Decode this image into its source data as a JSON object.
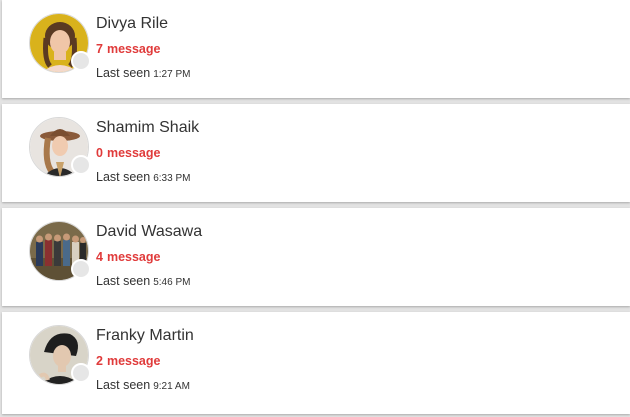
{
  "contacts": [
    {
      "name": "Divya Rile",
      "message_count": "7",
      "message_label": "message",
      "last_seen_label": "Last seen",
      "last_seen_time": "1:27 PM"
    },
    {
      "name": "Shamim Shaik",
      "message_count": "0",
      "message_label": "message",
      "last_seen_label": "Last seen",
      "last_seen_time": "6:33 PM"
    },
    {
      "name": "David Wasawa",
      "message_count": "4",
      "message_label": "message",
      "last_seen_label": "Last seen",
      "last_seen_time": "5:46 PM"
    },
    {
      "name": "Franky Martin",
      "message_count": "2",
      "message_label": "message",
      "last_seen_label": "Last seen",
      "last_seen_time": "9:21 AM"
    }
  ],
  "colors": {
    "message_count": "#e03b3b",
    "status_offline": "#e6e6e6"
  }
}
